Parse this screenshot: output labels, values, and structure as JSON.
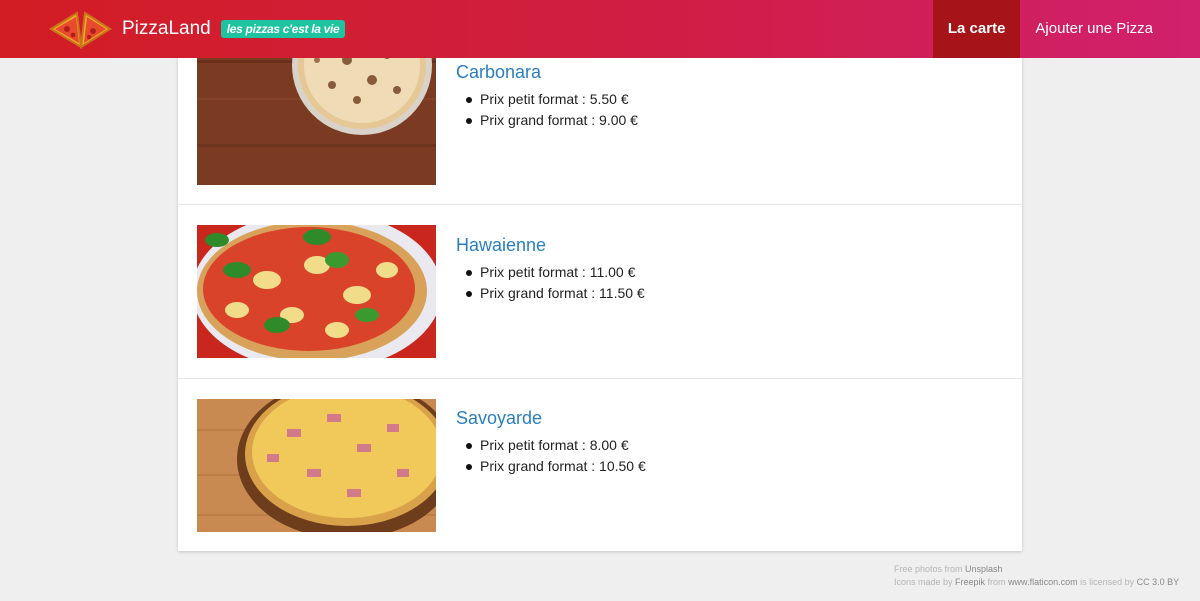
{
  "header": {
    "brand": "PizzaLand",
    "tagline": "les pizzas c'est la vie",
    "logo_icon": "pizza-slices-logo",
    "nav": {
      "menu_label": "La carte",
      "add_label": "Ajouter une Pizza"
    }
  },
  "pizzas": [
    {
      "name": "Carbonara",
      "small_price": "Prix petit format : 5.50 €",
      "large_price": "Prix grand format : 9.00 €",
      "image_icon": "carbonara-pizza-photo"
    },
    {
      "name": "Hawaienne",
      "small_price": "Prix petit format : 11.00 €",
      "large_price": "Prix grand format : 11.50 €",
      "image_icon": "hawaienne-pizza-photo"
    },
    {
      "name": "Savoyarde",
      "small_price": "Prix petit format : 8.00 €",
      "large_price": "Prix grand format : 10.50 €",
      "image_icon": "savoyarde-pizza-photo"
    }
  ],
  "footer": {
    "photos_prefix": "Free photos from ",
    "photos_source": "Unsplash",
    "icons_prefix": "Icons made by ",
    "icons_author": "Freepik",
    "icons_from": " from ",
    "icons_site": "www.flaticon.com",
    "icons_license_prefix": " is licensed by ",
    "icons_license": "CC 3.0 BY"
  },
  "colors": {
    "header_start": "#d21d24",
    "header_end": "#d1206d",
    "active_nav": "#a6141a",
    "tagline_bg": "#1ec3a0",
    "pizza_name": "#2a7fc0"
  }
}
